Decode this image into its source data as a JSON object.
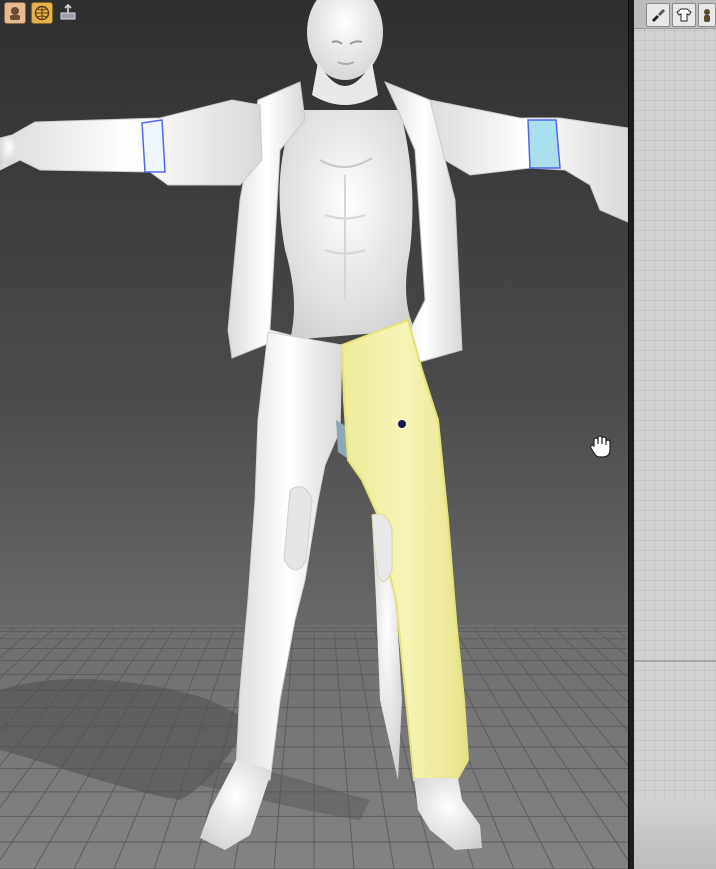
{
  "app": {
    "viewport_toolbar": {
      "icons": [
        "avatar-icon",
        "globe-icon",
        "export-icon"
      ]
    },
    "side_panel": {
      "toolbar_icons": [
        "brush-icon",
        "garment-icon",
        "figure-icon"
      ]
    },
    "scene": {
      "selected_pattern": "right-pant-leg",
      "colors": {
        "selection_fill": "#f2f0a6",
        "selection_outline": "#e4e07a",
        "cuff_highlight": "#a9dfee",
        "cuff_line": "#5566ee",
        "garment": "#f3f3f3",
        "background_top": "#2f2f2f",
        "floor": "#777777"
      }
    },
    "cursor": "hand-cursor-icon"
  }
}
